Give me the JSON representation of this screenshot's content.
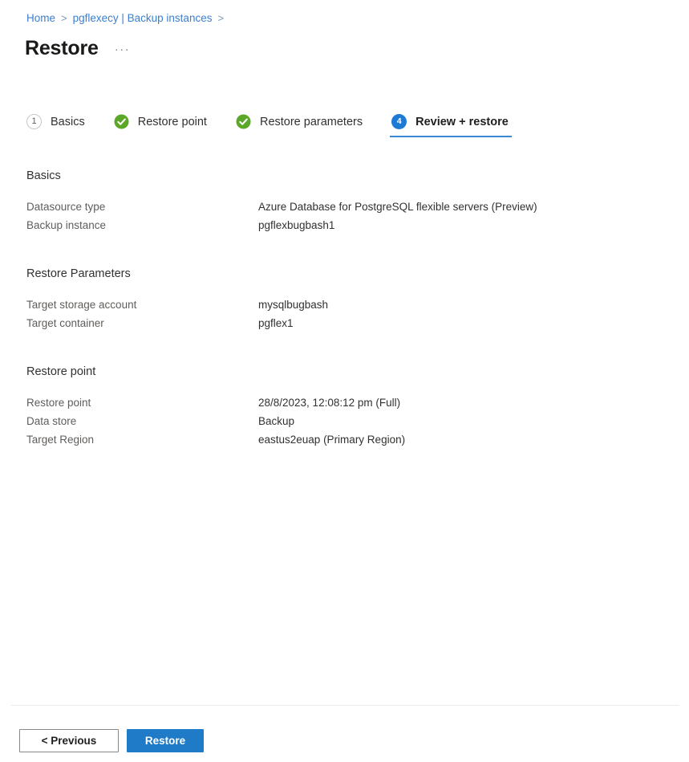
{
  "breadcrumb": {
    "items": [
      {
        "label": "Home",
        "separator": ">"
      },
      {
        "label": "pgflexecy | Backup instances",
        "separator": ">"
      }
    ],
    "link_color": "#3b7fd1"
  },
  "header": {
    "title": "Restore",
    "ellipsis": "···"
  },
  "wizard": {
    "active_index": 3,
    "accent_color": "#3b87d8",
    "done_color": "#5ba829",
    "tabs": [
      {
        "label": "Basics",
        "badge": "1",
        "state": "pending",
        "icon": "step-number-icon"
      },
      {
        "label": "Restore point",
        "badge": "",
        "state": "complete",
        "icon": "check-circle-icon"
      },
      {
        "label": "Restore parameters",
        "badge": "",
        "state": "complete",
        "icon": "check-circle-icon"
      },
      {
        "label": "Review + restore",
        "badge": "4",
        "state": "active",
        "icon": "step-number-icon"
      }
    ]
  },
  "sections": [
    {
      "heading": "Basics",
      "rows": [
        {
          "key": "Datasource type",
          "value": "Azure Database for PostgreSQL flexible servers (Preview)"
        },
        {
          "key": "Backup instance",
          "value": "pgflexbugbash1"
        }
      ]
    },
    {
      "heading": "Restore Parameters",
      "rows": [
        {
          "key": "Target storage account",
          "value": "mysqlbugbash"
        },
        {
          "key": "Target container",
          "value": "pgflex1"
        }
      ]
    },
    {
      "heading": "Restore point",
      "rows": [
        {
          "key": "Restore point",
          "value": "28/8/2023, 12:08:12 pm (Full)"
        },
        {
          "key": "Data store",
          "value": "Backup"
        },
        {
          "key": "Target Region",
          "value": "eastus2euap (Primary Region)"
        }
      ]
    }
  ],
  "footer": {
    "previous_label": "< Previous",
    "restore_label": "Restore",
    "primary_color": "#1f7ac7"
  }
}
